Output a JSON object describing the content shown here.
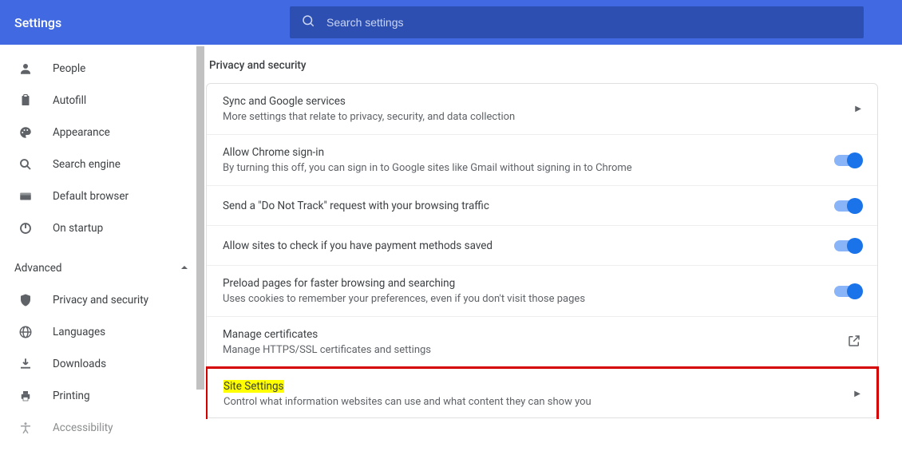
{
  "header": {
    "title": "Settings",
    "search_placeholder": "Search settings"
  },
  "sidebar": {
    "items": [
      {
        "icon": "person-icon",
        "label": "People"
      },
      {
        "icon": "clipboard-icon",
        "label": "Autofill"
      },
      {
        "icon": "palette-icon",
        "label": "Appearance"
      },
      {
        "icon": "search-icon",
        "label": "Search engine"
      },
      {
        "icon": "browser-icon",
        "label": "Default browser"
      },
      {
        "icon": "power-icon",
        "label": "On startup"
      }
    ],
    "advanced_label": "Advanced",
    "adv_items": [
      {
        "icon": "shield-icon",
        "label": "Privacy and security"
      },
      {
        "icon": "globe-icon",
        "label": "Languages"
      },
      {
        "icon": "download-icon",
        "label": "Downloads"
      },
      {
        "icon": "print-icon",
        "label": "Printing"
      },
      {
        "icon": "accessibility-icon",
        "label": "Accessibility"
      }
    ]
  },
  "content": {
    "section_title": "Privacy and security",
    "rows": [
      {
        "title": "Sync and Google services",
        "sub": "More settings that relate to privacy, security, and data collection",
        "action": "chevron"
      },
      {
        "title": "Allow Chrome sign-in",
        "sub": "By turning this off, you can sign in to Google sites like Gmail without signing in to Chrome",
        "action": "toggle"
      },
      {
        "title": "Send a \"Do Not Track\" request with your browsing traffic",
        "sub": "",
        "action": "toggle"
      },
      {
        "title": "Allow sites to check if you have payment methods saved",
        "sub": "",
        "action": "toggle"
      },
      {
        "title": "Preload pages for faster browsing and searching",
        "sub": "Uses cookies to remember your preferences, even if you don't visit those pages",
        "action": "toggle"
      },
      {
        "title": "Manage certificates",
        "sub": "Manage HTTPS/SSL certificates and settings",
        "action": "launch"
      },
      {
        "title": "Site Settings",
        "sub": "Control what information websites can use and what content they can show you",
        "action": "chevron"
      }
    ]
  }
}
